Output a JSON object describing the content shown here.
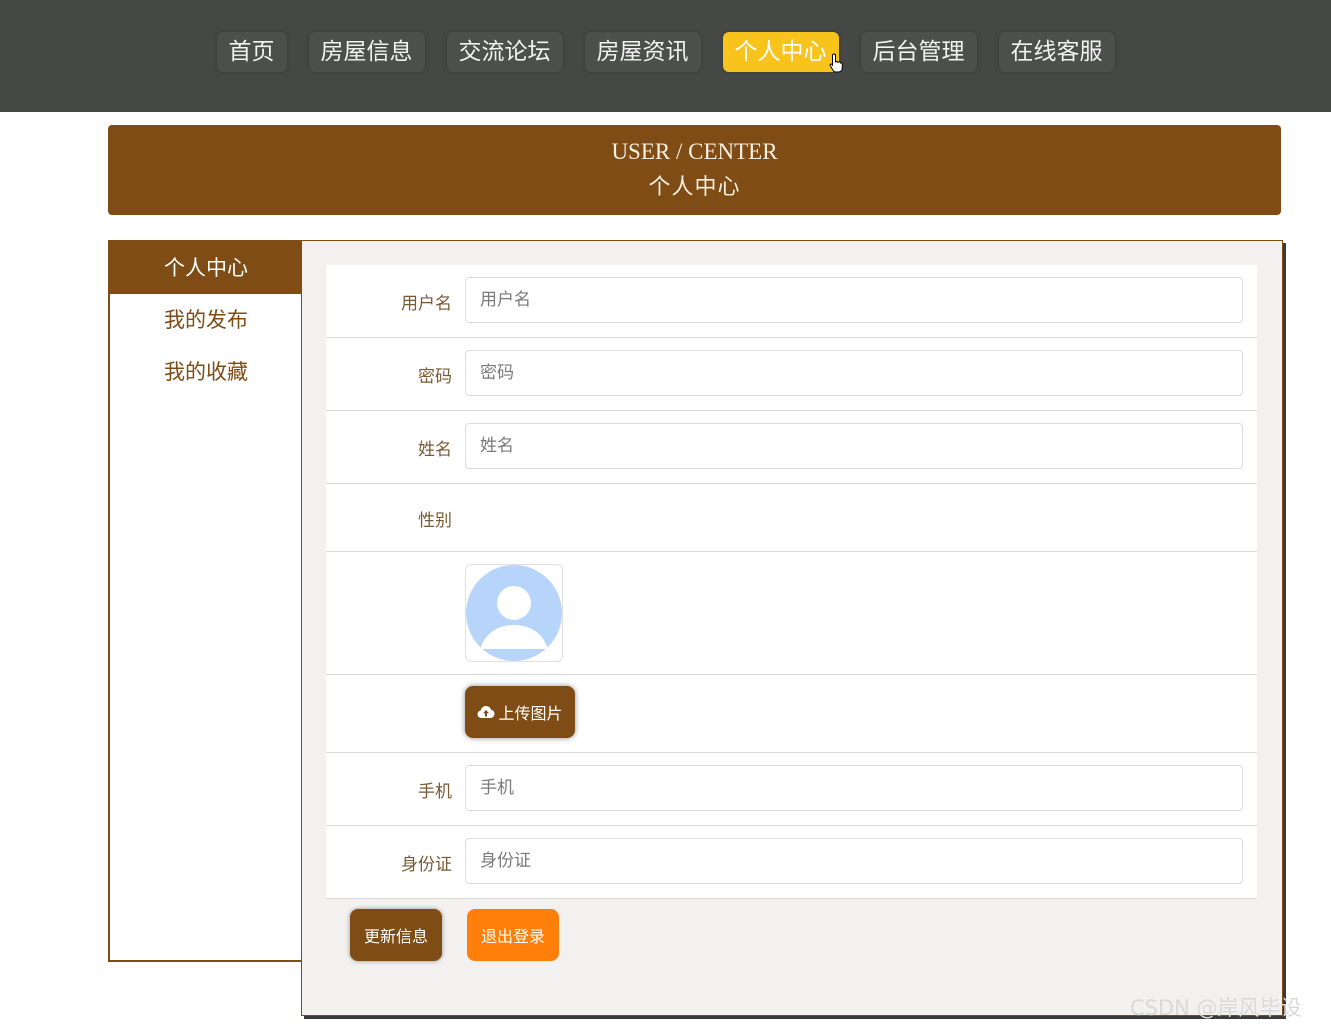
{
  "nav": {
    "items": [
      "首页",
      "房屋信息",
      "交流论坛",
      "房屋资讯",
      "个人中心",
      "后台管理",
      "在线客服"
    ],
    "active": "个人中心",
    "active_color": "#f8c31c"
  },
  "banner": {
    "title": "USER / CENTER",
    "subtitle": "个人中心",
    "color": "#7e4c14"
  },
  "sidebar": {
    "items": [
      "个人中心",
      "我的发布",
      "我的收藏"
    ],
    "active": "个人中心"
  },
  "form": {
    "username": {
      "label": "用户名",
      "placeholder": "用户名",
      "value": ""
    },
    "password": {
      "label": "密码",
      "placeholder": "密码",
      "value": ""
    },
    "name": {
      "label": "姓名",
      "placeholder": "姓名",
      "value": ""
    },
    "gender": {
      "label": "性别"
    },
    "upload_label": "上传图片",
    "phone": {
      "label": "手机",
      "placeholder": "手机",
      "value": ""
    },
    "idcard": {
      "label": "身份证",
      "placeholder": "身份证",
      "value": ""
    }
  },
  "actions": {
    "update_label": "更新信息",
    "logout_label": "退出登录",
    "logout_color": "#ff7f0a"
  },
  "watermark": "CSDN @岸风毕设",
  "icons": {
    "upload": "cloud-upload-icon",
    "avatar": "default-avatar",
    "cursor": "hand-pointer-cursor"
  }
}
